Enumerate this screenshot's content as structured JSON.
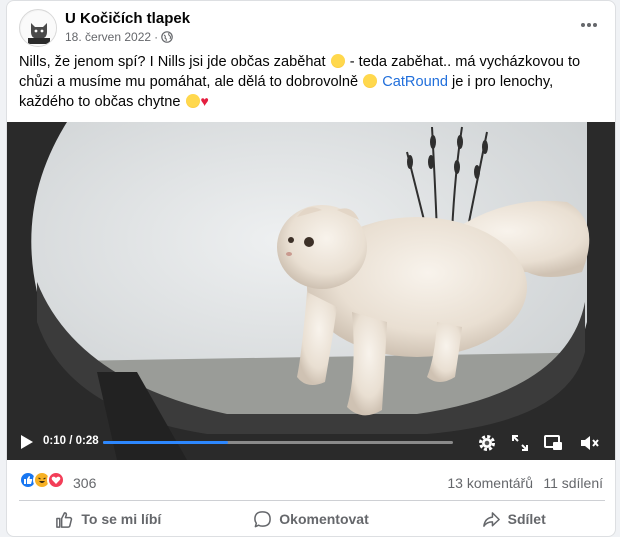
{
  "post": {
    "page_name": "U Kočičích tlapek",
    "date": "18. červen 2022",
    "separator": "·",
    "avatar_text": "TLAPEK",
    "text_part1": "Nills, že jenom spí? I Nills jsi jde občas zaběhat",
    "text_part2": " - teda zaběhat.. má vycházkovou to chůzi a musíme mu pomáhat, ale dělá to dobrovolně",
    "link_text": "CatRound",
    "text_part3": " je i pro lenochy, každého to občas chytne"
  },
  "video": {
    "time_display": "0:10 / 0:28",
    "progress": 0.357,
    "accent": "#2d88ff"
  },
  "stats": {
    "reaction_count": "306",
    "comments": "13 komentářů",
    "shares": "11 sdílení"
  },
  "actions": {
    "like": "To se mi líbí",
    "comment": "Okomentovat",
    "share": "Sdílet"
  },
  "icons": [
    "globe-icon",
    "more-icon",
    "play-icon",
    "settings-icon",
    "fullscreen-icon",
    "pip-icon",
    "mute-icon",
    "like-icon",
    "comment-icon",
    "share-icon"
  ]
}
